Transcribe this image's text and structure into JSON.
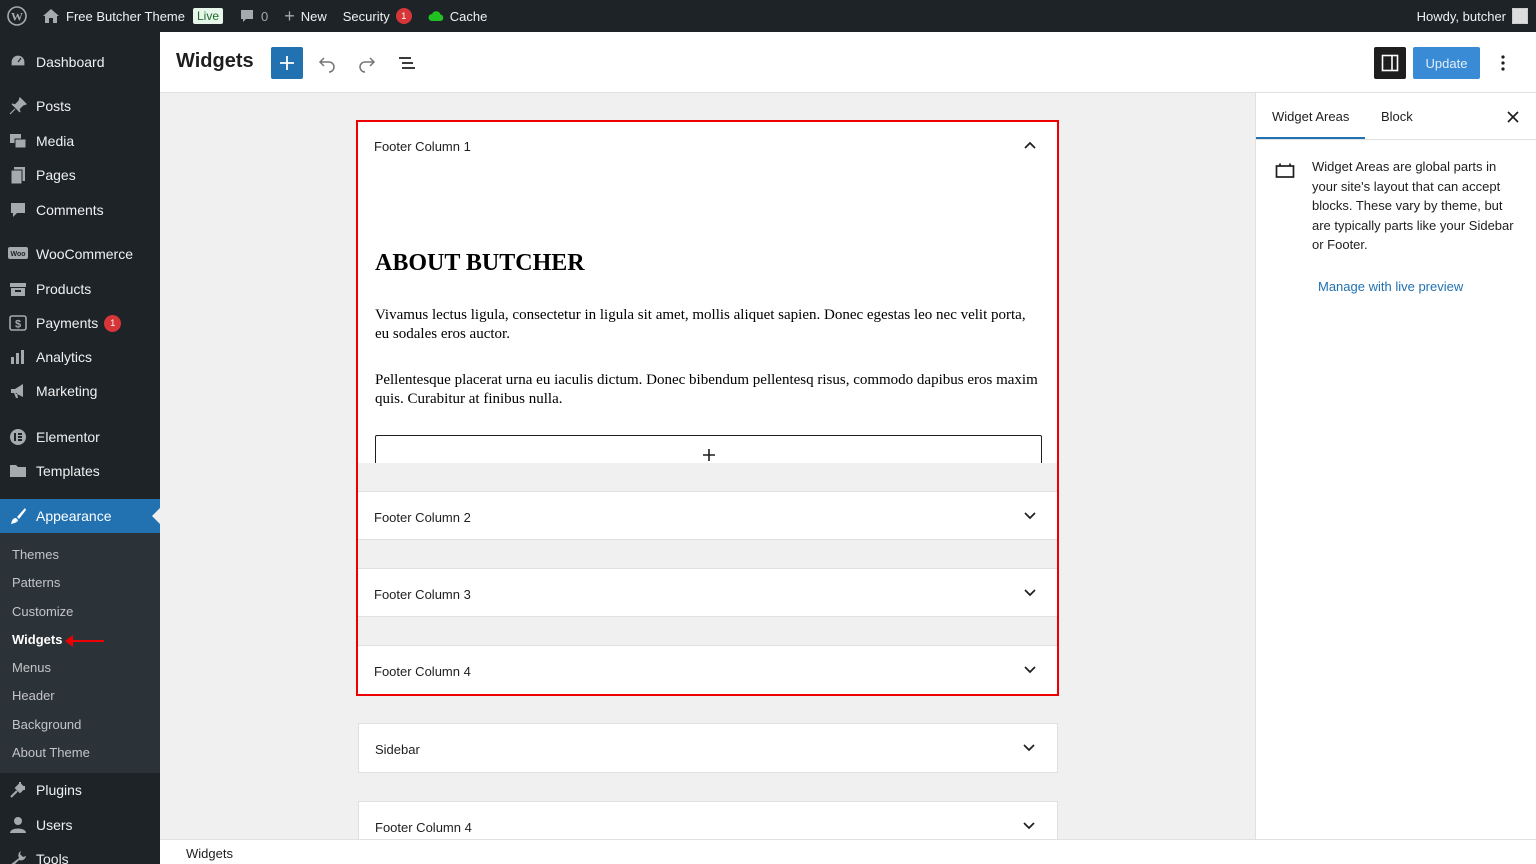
{
  "adminbar": {
    "site_name": "Free Butcher Theme",
    "live_badge": "Live",
    "comments_count": "0",
    "new_label": "New",
    "security_label": "Security",
    "security_count": "1",
    "cache_label": "Cache",
    "howdy": "Howdy, butcher"
  },
  "menu": {
    "dashboard": "Dashboard",
    "posts": "Posts",
    "media": "Media",
    "pages": "Pages",
    "comments": "Comments",
    "woocommerce": "WooCommerce",
    "products": "Products",
    "payments": "Payments",
    "payments_badge": "1",
    "analytics": "Analytics",
    "marketing": "Marketing",
    "elementor": "Elementor",
    "templates": "Templates",
    "appearance": "Appearance",
    "plugins": "Plugins",
    "users": "Users",
    "tools": "Tools",
    "submenu": [
      "Themes",
      "Patterns",
      "Customize",
      "Widgets",
      "Menus",
      "Header",
      "Background",
      "About Theme"
    ]
  },
  "header": {
    "title": "Widgets",
    "update_label": "Update"
  },
  "areas": {
    "footer1": "Footer Column 1",
    "footer2": "Footer Column 2",
    "footer3": "Footer Column 3",
    "footer4": "Footer Column 4",
    "sidebar": "Sidebar",
    "footer4b": "Footer Column 4"
  },
  "content": {
    "heading": "ABOUT BUTCHER",
    "para1": "Vivamus lectus ligula, consectetur in ligula sit amet, mollis aliquet sapien. Donec egestas leo nec velit porta, eu sodales eros auctor.",
    "para2": "Pellentesque placerat urna eu iaculis dictum. Donec bibendum pellentesq risus, commodo dapibus eros maxim quis. Curabitur at finibus nulla."
  },
  "sidebar_panel": {
    "tab_areas": "Widget Areas",
    "tab_block": "Block",
    "description": "Widget Areas are global parts in your site's layout that can accept blocks. These vary by theme, but are typically parts like your Sidebar or Footer.",
    "manage_link": "Manage with live preview"
  },
  "footer": {
    "breadcrumb": "Widgets"
  },
  "colors": {
    "accent": "#2271b1",
    "admin_bg": "#1d2327",
    "highlight": "#e00000"
  }
}
